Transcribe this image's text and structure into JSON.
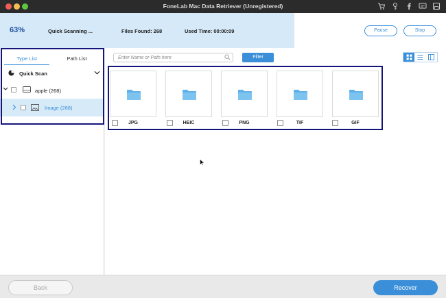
{
  "window": {
    "title": "FoneLab Mac Data Retriever (Unregistered)",
    "toolbar_icons": [
      "cart-icon",
      "key-icon",
      "facebook-icon",
      "chat-icon",
      "save-icon"
    ]
  },
  "scan": {
    "percent_label": "63%",
    "progress": 0.66,
    "status": "Quick Scanning ...",
    "files_found": "Files Found: 268",
    "used_time": "Used Time: 00:00:09",
    "pause_label": "Pause",
    "stop_label": "Stop"
  },
  "sidebar": {
    "tabs": [
      {
        "label": "Type List",
        "active": true
      },
      {
        "label": "Path List",
        "active": false
      }
    ],
    "scan_mode": "Quick Scan",
    "tree": [
      {
        "label": "apple (268)",
        "expanded": true
      },
      {
        "label": "Image (268)",
        "selected": true
      }
    ]
  },
  "main": {
    "search_placeholder": "Enter Name or Path here",
    "filter_label": "Filter",
    "view_modes": [
      "grid-view-icon",
      "list-view-icon",
      "column-view-icon"
    ],
    "active_view": "grid-view-icon",
    "folders": [
      {
        "label": "JPG"
      },
      {
        "label": "HEIC"
      },
      {
        "label": "PNG"
      },
      {
        "label": "TIF"
      },
      {
        "label": "GIF"
      }
    ]
  },
  "footer": {
    "back_label": "Back",
    "recover_label": "Recover"
  },
  "colors": {
    "accent": "#3a8fd8",
    "progress_fill": "#d5e9f8",
    "selected_row": "#d6eaf8",
    "highlight_outline": "#14147a",
    "folder": "#5fb0e8"
  }
}
